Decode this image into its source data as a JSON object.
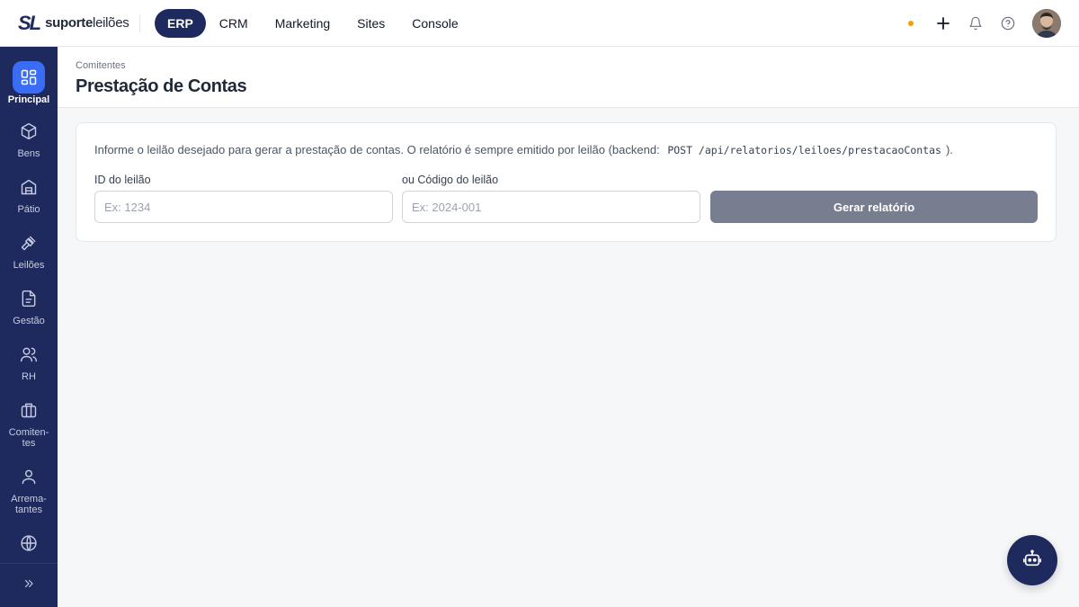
{
  "brand": {
    "mark": "SL",
    "name_bold": "suporte",
    "name_light": "leilões"
  },
  "topnav": {
    "items": [
      {
        "label": "ERP",
        "active": true
      },
      {
        "label": "CRM"
      },
      {
        "label": "Marketing"
      },
      {
        "label": "Sites"
      },
      {
        "label": "Console"
      }
    ],
    "status_color": "#f59e0b",
    "actions": [
      "plus-icon",
      "bell-icon",
      "help-icon",
      "avatar"
    ]
  },
  "sidebar": {
    "items": [
      {
        "label": "Principal",
        "icon": "grid-icon",
        "active": true
      },
      {
        "label": "Bens",
        "icon": "box-icon"
      },
      {
        "label": "Pátio",
        "icon": "building-icon"
      },
      {
        "label": "Leilões",
        "icon": "gavel-icon"
      },
      {
        "label": "Gestão",
        "icon": "document-icon"
      },
      {
        "label": "RH",
        "icon": "users-icon"
      },
      {
        "label": "Comiten-",
        "label2": "tes",
        "icon": "briefcase-icon"
      },
      {
        "label": "Arrema-",
        "label2": "tantes",
        "icon": "user-icon"
      },
      {
        "label": "",
        "icon": "globe-icon"
      }
    ],
    "expand_icon": "chevrons-right-icon"
  },
  "header": {
    "breadcrumb": "Comitentes",
    "title": "Prestação de Contas"
  },
  "form": {
    "info_prefix": "Informe o leilão desejado para gerar a prestação de contas. O relatório é sempre emitido por leilão (backend:",
    "info_code": "POST /api/relatorios/leiloes/prestacaoContas",
    "info_suffix": ").",
    "id_label": "ID do leilão",
    "id_placeholder": "Ex: 1234",
    "code_label": "ou Código do leilão",
    "code_placeholder": "Ex: 2024-001",
    "submit_label": "Gerar relatório"
  },
  "colors": {
    "navy": "#1e2a5e",
    "active_blue": "#3b6cf6",
    "button_disabled": "#777e8f"
  },
  "assistant": {
    "icon": "robot-icon"
  }
}
